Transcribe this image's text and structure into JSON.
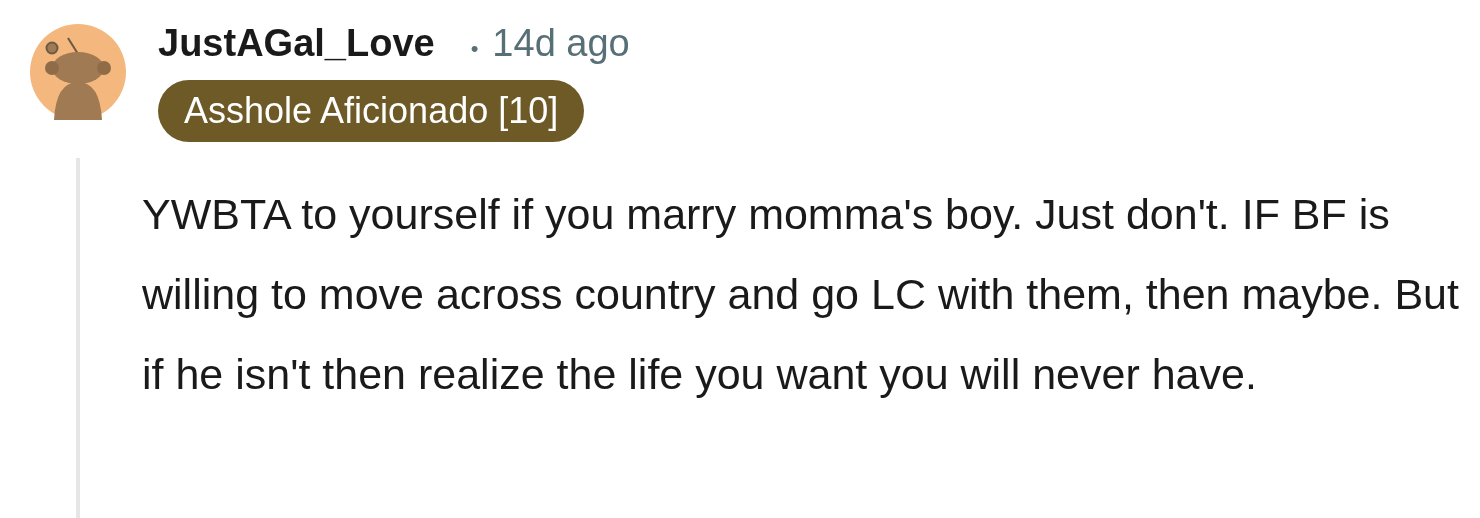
{
  "comment": {
    "username": "JustAGal_Love",
    "separator": "•",
    "time": "14d ago",
    "flair": "Asshole Aficionado [10]",
    "body": "YWBTA to yourself if you marry momma's boy. Just don't. IF BF is willing to move across country and go LC with them, then maybe. But if he isn't then realize the life you want you will never have."
  }
}
